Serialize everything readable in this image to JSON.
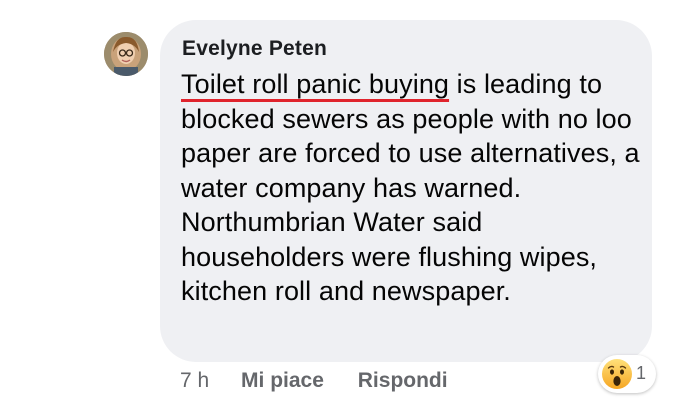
{
  "comment": {
    "author": "Evelyne Peten",
    "underlined_text": "Toilet roll panic buying",
    "paragraph1_rest": " is leading to blocked sewers as people with no loo paper are forced to use alternatives, a water company has warned.",
    "paragraph2": "Northumbrian Water said householders were flushing wipes, kitchen roll and newspaper.",
    "underline_color": "#e0242d",
    "bubble_color": "#eff0f3"
  },
  "actions": {
    "timestamp": "7 h",
    "like_label": "Mi piace",
    "reply_label": "Rispondi"
  },
  "reaction": {
    "icon": "wow-emoji-icon",
    "count": "1"
  }
}
